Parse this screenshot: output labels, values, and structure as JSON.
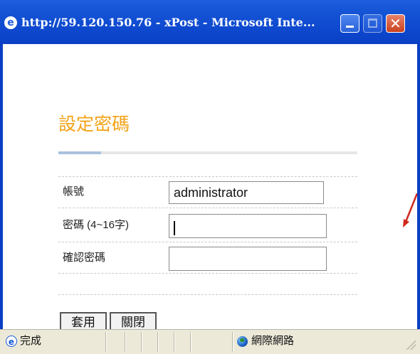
{
  "window": {
    "title": "http://59.120.150.76 - xPost - Microsoft Inte...",
    "close_symbol": "✕"
  },
  "page": {
    "title": "設定密碼",
    "fields": [
      {
        "label": "帳號",
        "value": "administrator"
      },
      {
        "label": "密碼 (4~16字)",
        "value": ""
      },
      {
        "label": "確認密碼",
        "value": ""
      }
    ],
    "buttons": {
      "apply": "套用",
      "close": "關閉"
    }
  },
  "statusbar": {
    "status": "完成",
    "zone": "網際網路"
  },
  "colors": {
    "title_orange": "#f3a317",
    "titlebar_blue": "#1656d6",
    "annotation_arrow": "#d0281c"
  },
  "icons": {
    "window": "ie-icon",
    "status": "ie-page-icon",
    "zone": "globe-icon",
    "annotation": "red-arrow-icon"
  }
}
